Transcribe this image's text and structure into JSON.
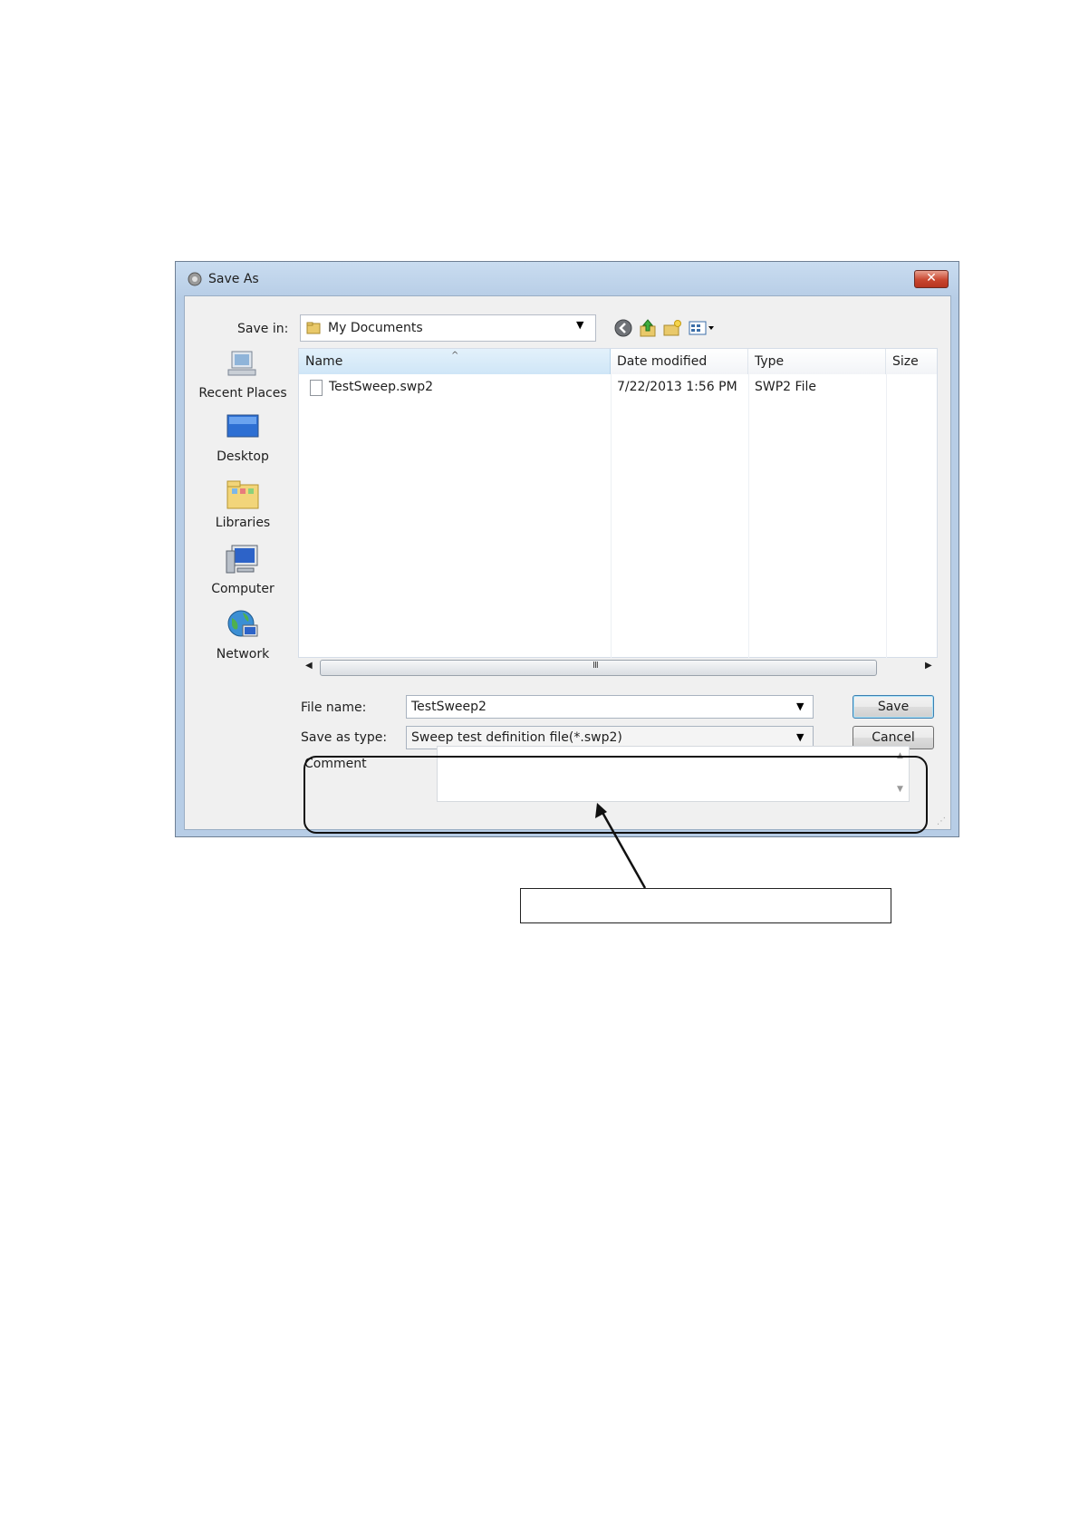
{
  "window": {
    "title": "Save As",
    "close_label": "✕"
  },
  "toolbar": {
    "save_in_label": "Save in:",
    "save_in_value": "My Documents",
    "icons": [
      "back-icon",
      "up-folder-icon",
      "new-folder-icon",
      "views-menu-icon"
    ]
  },
  "places": [
    {
      "label": "Recent Places",
      "icon": "recent-places-icon"
    },
    {
      "label": "Desktop",
      "icon": "desktop-icon"
    },
    {
      "label": "Libraries",
      "icon": "libraries-icon"
    },
    {
      "label": "Computer",
      "icon": "computer-icon"
    },
    {
      "label": "Network",
      "icon": "network-icon"
    }
  ],
  "file_list": {
    "columns": [
      "Name",
      "Date modified",
      "Type",
      "Size"
    ],
    "rows": [
      {
        "name": "TestSweep.swp2",
        "date_modified": "7/22/2013 1:56 PM",
        "type": "SWP2 File",
        "size": ""
      }
    ],
    "scroll_grip": "III"
  },
  "form": {
    "file_name_label": "File name:",
    "file_name_value": "TestSweep2",
    "save_as_type_label": "Save as type:",
    "save_as_type_value": "Sweep test definition file(*.swp2)",
    "save_button": "Save",
    "cancel_button": "Cancel",
    "comment_label": "Comment",
    "comment_value": ""
  },
  "annotation": {
    "callout_text": ""
  },
  "colors": {
    "title_bar": "#b7cde6",
    "client_bg": "#f0f0f0",
    "close_button": "#c8462f",
    "header_selected": "#cfe6f7"
  }
}
